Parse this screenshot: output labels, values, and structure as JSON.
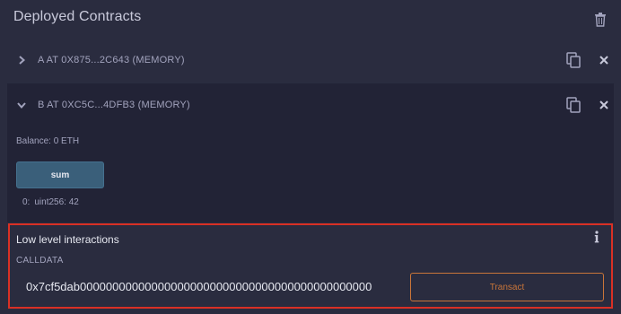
{
  "header": {
    "title": "Deployed Contracts"
  },
  "contracts": [
    {
      "label": "A AT 0X875...2C643 (MEMORY)",
      "expanded": false
    },
    {
      "label": "B AT 0XC5C...4DFB3 (MEMORY)",
      "expanded": true
    }
  ],
  "contract_b": {
    "balance": "Balance: 0 ETH",
    "function_button": "sum",
    "result_index": "0:",
    "result_value": "uint256: 42"
  },
  "low_level": {
    "title": "Low level interactions",
    "calldata_label": "CALLDATA",
    "calldata_value": "0x7cf5dab000000000000000000000000000000000000000000000",
    "transact_label": "Transact"
  },
  "colors": {
    "background": "#2a2c3f",
    "panel": "#222336",
    "highlight_border": "#d93025",
    "transact_accent": "#c97539",
    "button_bg": "#3a5f7a"
  },
  "icons": [
    "trash-icon",
    "chevron-right-icon",
    "chevron-down-icon",
    "copy-icon",
    "close-icon",
    "info-icon"
  ]
}
